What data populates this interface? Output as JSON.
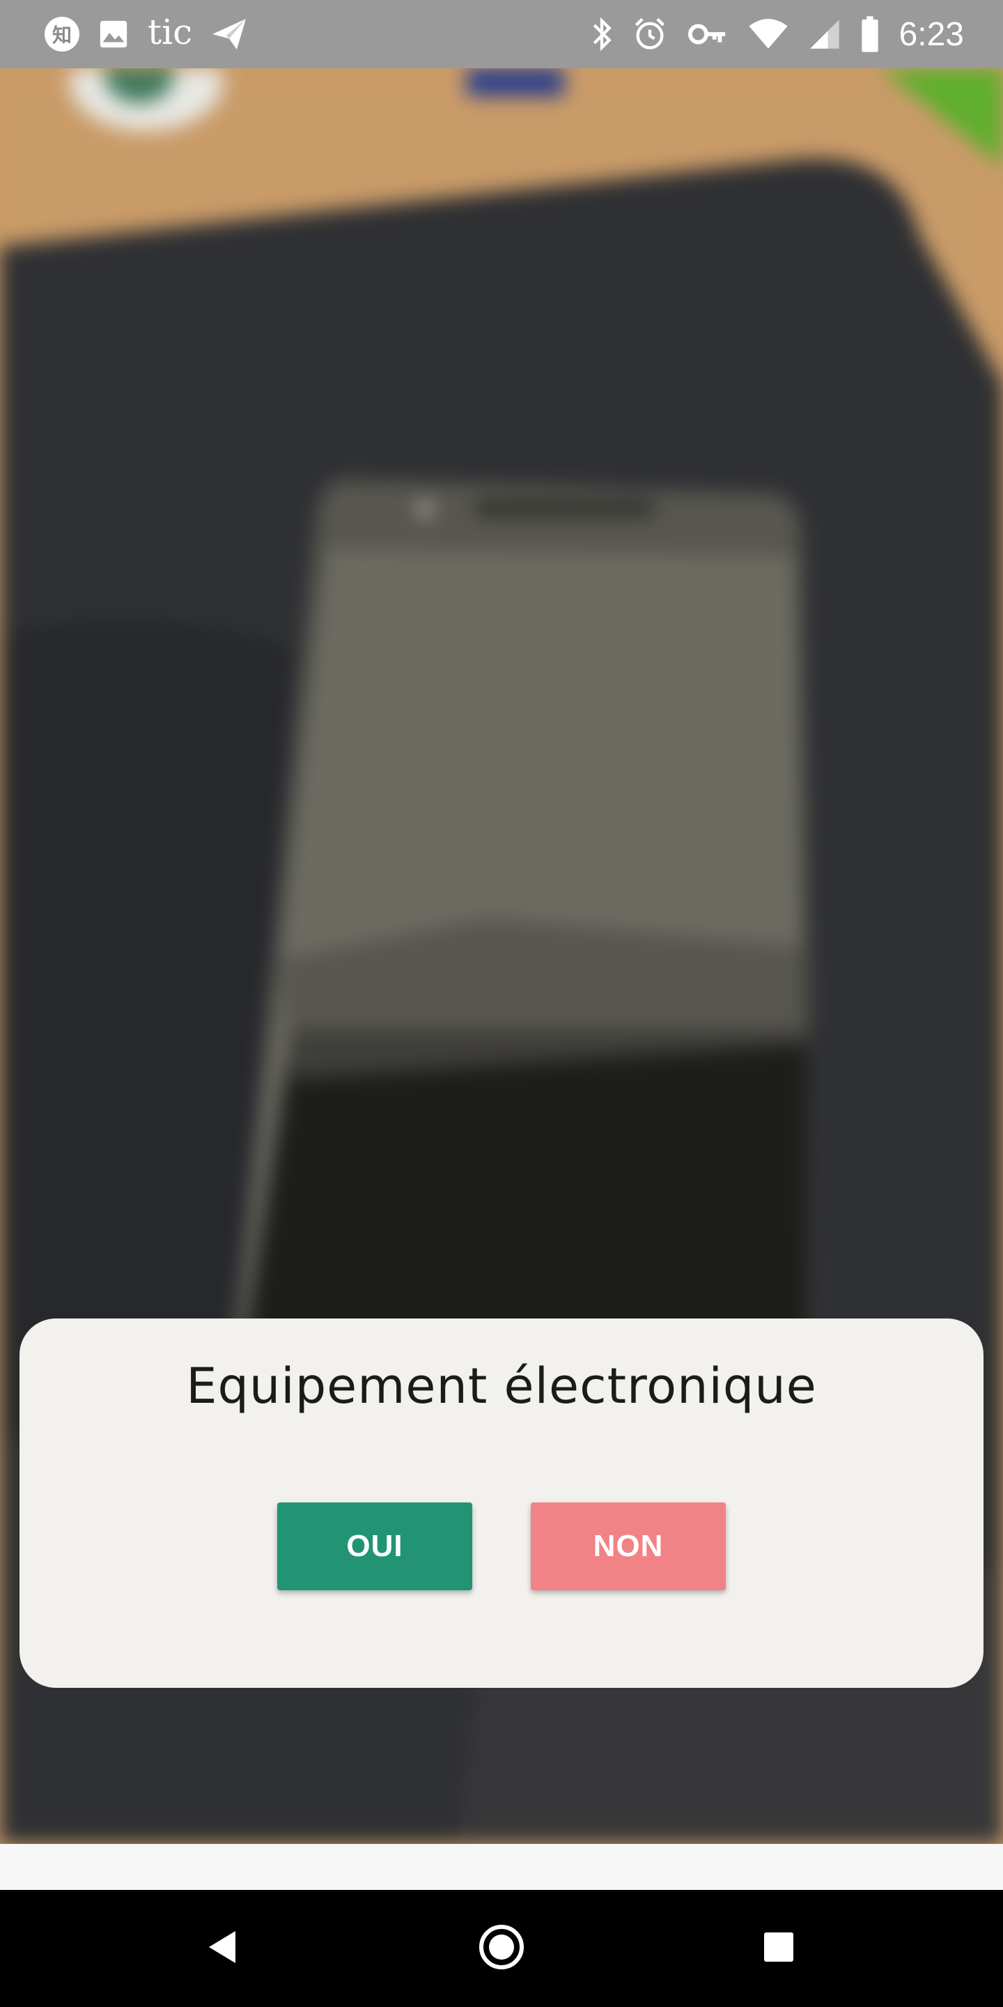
{
  "status_bar": {
    "left_icons": [
      "zhihu-icon",
      "image-icon",
      "tic-app-icon",
      "send-icon"
    ],
    "zhihu_glyph": "知",
    "app_text": "tic",
    "right_icons": [
      "bluetooth-icon",
      "alarm-icon",
      "vpn-key-icon",
      "wifi-icon",
      "cell-signal-icon",
      "battery-icon"
    ],
    "time": "6:23"
  },
  "camera_preview": {
    "subject": "phone-on-desk-mat"
  },
  "dialog": {
    "title": "Equipement électronique",
    "buttons": {
      "oui_label": "OUI",
      "non_label": "NON"
    }
  },
  "nav_bar": {
    "icons": [
      "back-icon",
      "home-icon",
      "recents-icon"
    ]
  },
  "colors": {
    "status_bar_bg": "#9a9a9a",
    "dialog_bg": "#f2f1ed",
    "oui_button": "#229474",
    "non_button": "#f18286",
    "nav_bar_bg": "#000000"
  }
}
